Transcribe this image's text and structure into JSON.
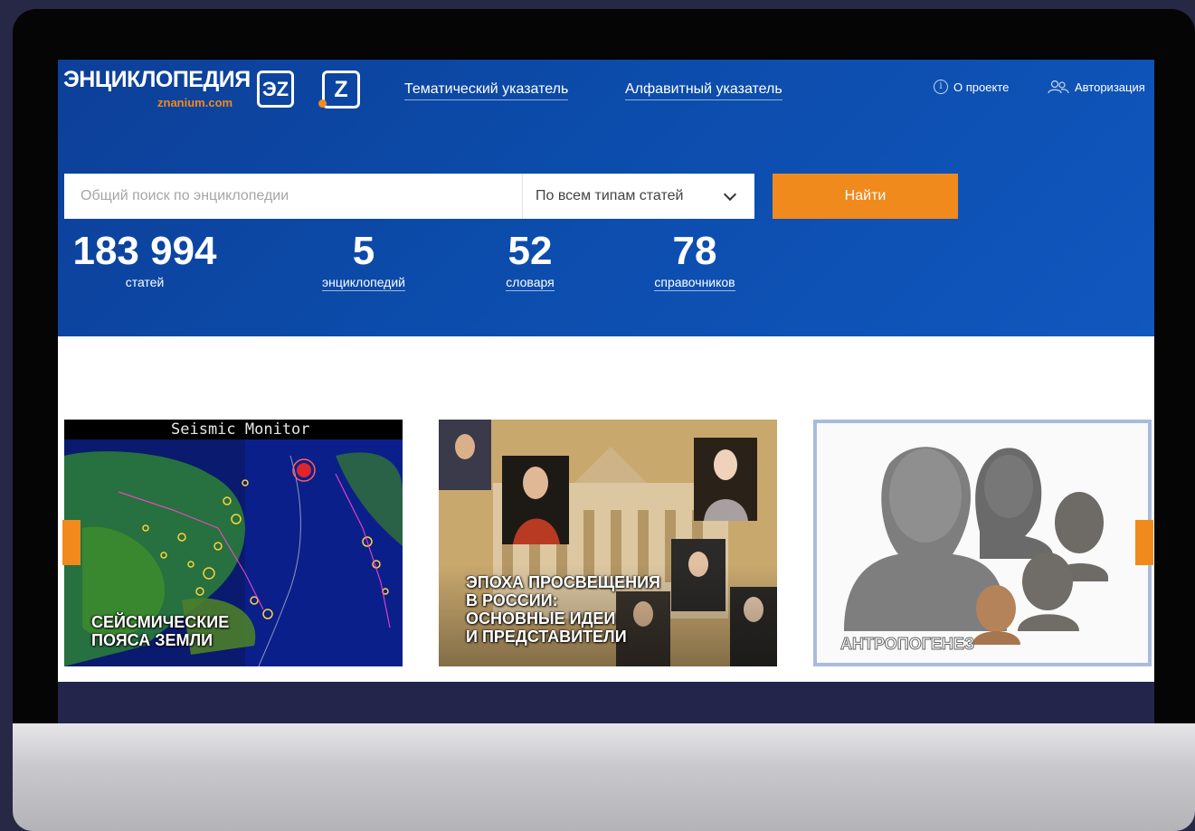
{
  "header": {
    "logo_text": "ЭНЦИКЛОПЕДИЯ",
    "logo_subtext": "znanium.com",
    "logo_badge_1": "ЭZ",
    "logo_badge_2": "Z",
    "nav": [
      "Тематический указатель",
      "Алфавитный указатель"
    ],
    "about_label": "О проекте",
    "login_label": "Авторизация"
  },
  "search": {
    "placeholder": "Общий поиск по энциклопедии",
    "type_selected": "По всем типам статей",
    "button_label": "Найти"
  },
  "stats": [
    {
      "number": "183 994",
      "label": "статей"
    },
    {
      "number": "5",
      "label": "энциклопедий"
    },
    {
      "number": "52",
      "label": "словаря"
    },
    {
      "number": "78",
      "label": "справочников"
    }
  ],
  "cards": [
    {
      "title_line1": "СЕЙСМИЧЕСКИЕ",
      "title_line2": "ПОЯСА ЗЕМЛИ",
      "overlay": "Seismic Monitor"
    },
    {
      "title_line1": "ЭПОХА ПРОСВЕЩЕНИЯ",
      "title_line2": "В РОССИИ:",
      "title_line3": "ОСНОВНЫЕ ИДЕИ",
      "title_line4": "И ПРЕДСТАВИТЕЛИ"
    },
    {
      "title_line1": "АНТРОПОГЕНЕЗ"
    }
  ],
  "colors": {
    "accent": "#f08a1c",
    "hero": "#0c4cab",
    "frame": "#262845"
  }
}
